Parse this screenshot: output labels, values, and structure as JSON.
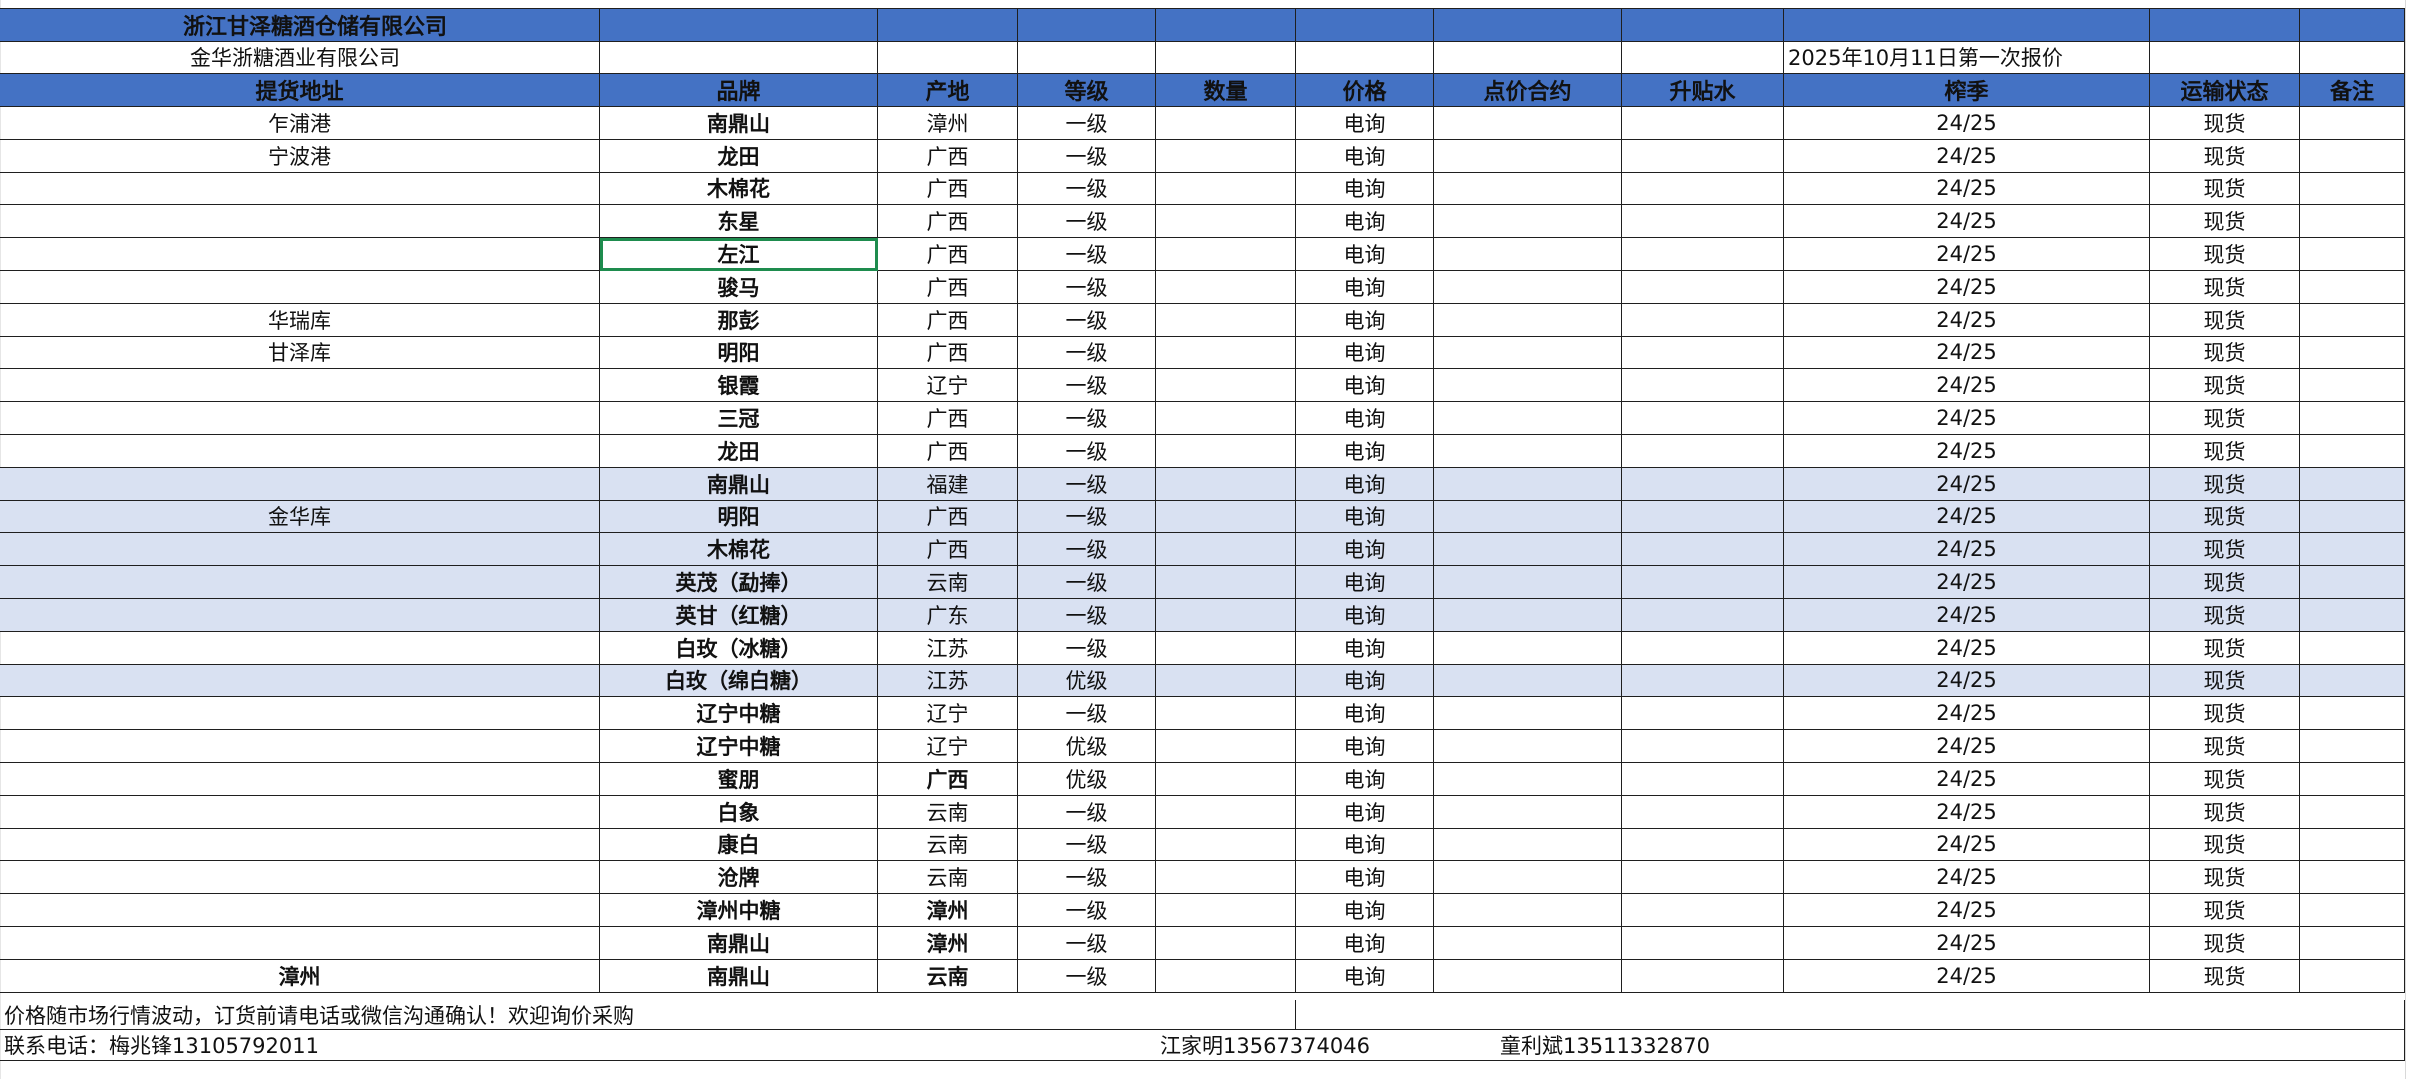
{
  "title_row": {
    "company": "浙江甘泽糖酒仓储有限公司"
  },
  "sub_row": {
    "company": "金华浙糖酒业有限公司",
    "quote_date": "2025年10月11日第一次报价"
  },
  "headers": [
    "提货地址",
    "品牌",
    "产地",
    "等级",
    "数量",
    "价格",
    "点价合约",
    "升贴水",
    "榨季",
    "运输状态",
    "备注"
  ],
  "rows": [
    {
      "addr": "乍浦港",
      "brand": "南鼎山",
      "origin": "漳州",
      "grade": "一级",
      "price": "电询",
      "season": "24/25",
      "status": "现货"
    },
    {
      "addr": "宁波港",
      "brand": "龙田",
      "origin": "广西",
      "grade": "一级",
      "price": "电询",
      "season": "24/25",
      "status": "现货"
    },
    {
      "addr": "",
      "brand": "木棉花",
      "origin": "广西",
      "grade": "一级",
      "price": "电询",
      "season": "24/25",
      "status": "现货"
    },
    {
      "addr": "",
      "brand": "东星",
      "origin": "广西",
      "grade": "一级",
      "price": "电询",
      "season": "24/25",
      "status": "现货"
    },
    {
      "addr": "",
      "brand": "左江",
      "origin": "广西",
      "grade": "一级",
      "price": "电询",
      "season": "24/25",
      "status": "现货"
    },
    {
      "addr": "",
      "brand": "骏马",
      "origin": "广西",
      "grade": "一级",
      "price": "电询",
      "season": "24/25",
      "status": "现货"
    },
    {
      "addr": "华瑞库",
      "brand": "那彭",
      "origin": "广西",
      "grade": "一级",
      "price": "电询",
      "season": "24/25",
      "status": "现货"
    },
    {
      "addr": "甘泽库",
      "brand": "明阳",
      "origin": "广西",
      "grade": "一级",
      "price": "电询",
      "season": "24/25",
      "status": "现货"
    },
    {
      "addr": "",
      "brand": "银霞",
      "origin": "辽宁",
      "grade": "一级",
      "price": "电询",
      "season": "24/25",
      "status": "现货"
    },
    {
      "addr": "",
      "brand": "三冠",
      "origin": "广西",
      "grade": "一级",
      "price": "电询",
      "season": "24/25",
      "status": "现货"
    },
    {
      "addr": "",
      "brand": "龙田",
      "origin": "广西",
      "grade": "一级",
      "price": "电询",
      "season": "24/25",
      "status": "现货"
    },
    {
      "addr": "",
      "brand": "南鼎山",
      "origin": "福建",
      "grade": "一级",
      "price": "电询",
      "season": "24/25",
      "status": "现货"
    },
    {
      "addr": "金华库",
      "brand": "明阳",
      "origin": "广西",
      "grade": "一级",
      "price": "电询",
      "season": "24/25",
      "status": "现货"
    },
    {
      "addr": "",
      "brand": "木棉花",
      "origin": "广西",
      "grade": "一级",
      "price": "电询",
      "season": "24/25",
      "status": "现货"
    },
    {
      "addr": "",
      "brand": "英茂（勐捧）",
      "origin": "云南",
      "grade": "一级",
      "price": "电询",
      "season": "24/25",
      "status": "现货"
    },
    {
      "addr": "",
      "brand": "英甘（红糖）",
      "origin": "广东",
      "grade": "一级",
      "price": "电询",
      "season": "24/25",
      "status": "现货"
    },
    {
      "addr": "",
      "brand": "白玫（冰糖）",
      "origin": "江苏",
      "grade": "一级",
      "price": "电询",
      "season": "24/25",
      "status": "现货"
    },
    {
      "addr": "",
      "brand": "白玫（绵白糖）",
      "origin": "江苏",
      "grade": "优级",
      "price": "电询",
      "season": "24/25",
      "status": "现货"
    },
    {
      "addr": "",
      "brand": "辽宁中糖",
      "origin": "辽宁",
      "grade": "一级",
      "price": "电询",
      "season": "24/25",
      "status": "现货"
    },
    {
      "addr": "",
      "brand": "辽宁中糖",
      "origin": "辽宁",
      "grade": "优级",
      "price": "电询",
      "season": "24/25",
      "status": "现货"
    },
    {
      "addr": "",
      "brand": "蜜朋",
      "origin": "广西",
      "grade": "优级",
      "price": "电询",
      "season": "24/25",
      "status": "现货"
    },
    {
      "addr": "",
      "brand": "白象",
      "origin": "云南",
      "grade": "一级",
      "price": "电询",
      "season": "24/25",
      "status": "现货"
    },
    {
      "addr": "",
      "brand": "康白",
      "origin": "云南",
      "grade": "一级",
      "price": "电询",
      "season": "24/25",
      "status": "现货"
    },
    {
      "addr": "",
      "brand": "沧牌",
      "origin": "云南",
      "grade": "一级",
      "price": "电询",
      "season": "24/25",
      "status": "现货"
    },
    {
      "addr": "",
      "brand": "漳州中糖",
      "origin": "漳州",
      "grade": "一级",
      "price": "电询",
      "season": "24/25",
      "status": "现货"
    },
    {
      "addr": "",
      "brand": "南鼎山",
      "origin": "漳州",
      "grade": "一级",
      "price": "电询",
      "season": "24/25",
      "status": "现货"
    },
    {
      "addr": "漳州",
      "brand": "南鼎山",
      "origin": "云南",
      "grade": "一级",
      "price": "电询",
      "season": "24/25",
      "status": "现货"
    }
  ],
  "footer": {
    "notice": "价格随市场行情波动，订货前请电话或微信沟通确认！欢迎询价采购",
    "contact1": "联系电话：梅兆锋13105792011",
    "contact2": "江家明13567374046",
    "contact3": "童利斌13511332870"
  },
  "colors": {
    "header_fill": "#4472c4",
    "shaded_fill": "#d9e1f2",
    "selection": "#1e8c4e"
  }
}
